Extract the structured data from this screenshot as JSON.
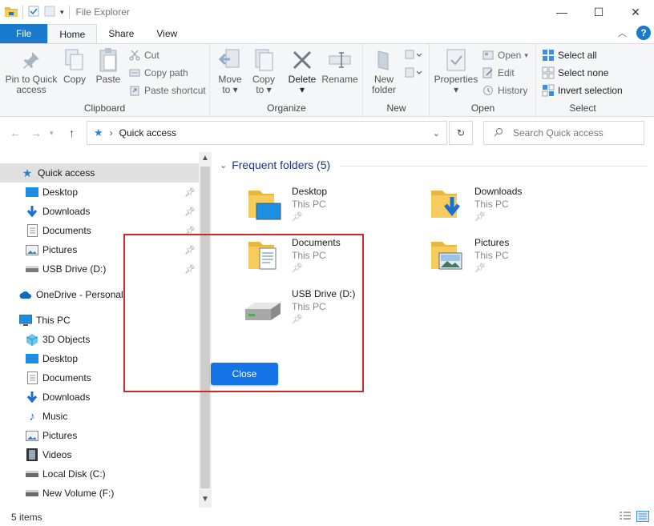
{
  "window": {
    "title": "File Explorer",
    "controls": {
      "minimize": "—",
      "maximize": "☐",
      "close": "✕"
    }
  },
  "tabs": [
    {
      "label": "File"
    },
    {
      "label": "Home"
    },
    {
      "label": "Share"
    },
    {
      "label": "View"
    }
  ],
  "ribbon": {
    "clipboard": {
      "label": "Clipboard",
      "pin_line1": "Pin to Quick",
      "pin_line2": "access",
      "copy": "Copy",
      "paste": "Paste",
      "cut": "Cut",
      "copy_path": "Copy path",
      "paste_shortcut": "Paste shortcut"
    },
    "organize": {
      "label": "Organize",
      "move_line1": "Move",
      "move_line2": "to",
      "copy_line1": "Copy",
      "copy_line2": "to",
      "delete": "Delete",
      "rename": "Rename"
    },
    "new": {
      "label": "New",
      "new_folder_line1": "New",
      "new_folder_line2": "folder"
    },
    "open": {
      "label": "Open",
      "properties": "Properties",
      "open": "Open",
      "edit": "Edit",
      "history": "History"
    },
    "select": {
      "label": "Select",
      "select_all": "Select all",
      "select_none": "Select none",
      "invert": "Invert selection"
    }
  },
  "address": {
    "path": "Quick access",
    "search_placeholder": "Search Quick access"
  },
  "nav": {
    "quick_access": "Quick access",
    "qa_items": [
      {
        "label": "Desktop"
      },
      {
        "label": "Downloads"
      },
      {
        "label": "Documents"
      },
      {
        "label": "Pictures"
      },
      {
        "label": "USB Drive (D:)"
      }
    ],
    "onedrive": "OneDrive - Personal",
    "this_pc": "This PC",
    "pc_items": [
      {
        "label": "3D Objects"
      },
      {
        "label": "Desktop"
      },
      {
        "label": "Documents"
      },
      {
        "label": "Downloads"
      },
      {
        "label": "Music"
      },
      {
        "label": "Pictures"
      },
      {
        "label": "Videos"
      },
      {
        "label": "Local Disk (C:)"
      },
      {
        "label": "New Volume (F:)"
      }
    ]
  },
  "content": {
    "section_title": "Frequent folders (5)",
    "folders": [
      {
        "name": "Desktop",
        "location": "This PC"
      },
      {
        "name": "Downloads",
        "location": "This PC"
      },
      {
        "name": "Documents",
        "location": "This PC"
      },
      {
        "name": "Pictures",
        "location": "This PC"
      },
      {
        "name": "USB Drive (D:)",
        "location": "This PC"
      }
    ]
  },
  "status": {
    "items": "5 items"
  },
  "overlay": {
    "close_label": "Close"
  },
  "colors": {
    "accent": "#1979ca",
    "overlay_border": "#cc2a2a",
    "close_button": "#1473e6"
  }
}
